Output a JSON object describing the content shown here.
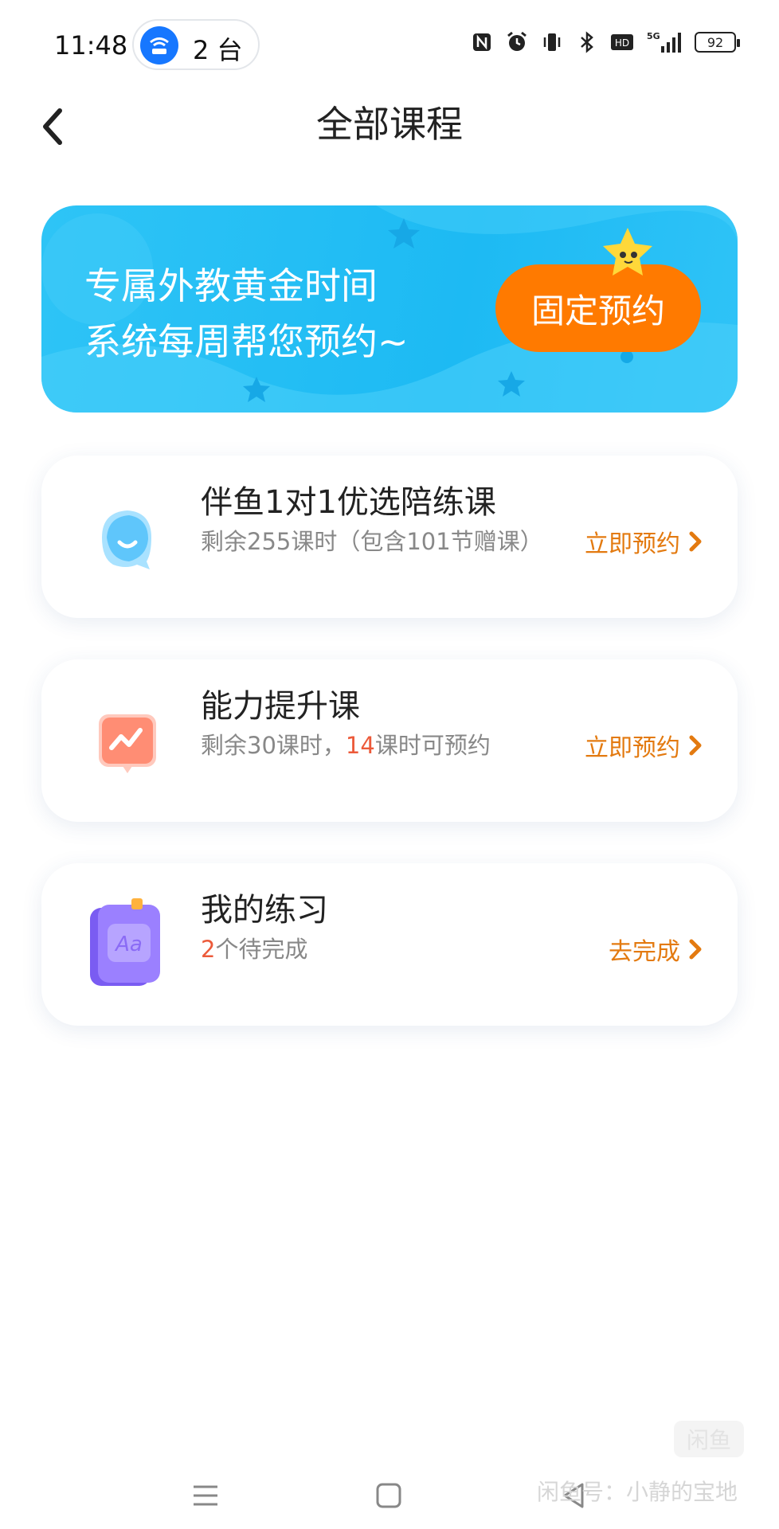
{
  "status_bar": {
    "time": "11:48",
    "hotspot_count": "2 台",
    "battery": "92"
  },
  "nav": {
    "title": "全部课程"
  },
  "banner": {
    "line1": "专属外教黄金时间",
    "line2": "系统每周帮您预约~",
    "button": "固定预约"
  },
  "courses": [
    {
      "title": "伴鱼1对1优选陪练课",
      "sub": "剩余255课时（包含101节赠课）",
      "action": "立即预约"
    },
    {
      "title": "能力提升课",
      "sub_prefix": "剩余30课时，",
      "sub_highlight": "14",
      "sub_suffix": "课时可预约",
      "action": "立即预约"
    },
    {
      "title": "我的练习",
      "sub_highlight": "2",
      "sub_suffix": "个待完成",
      "action": "去完成"
    }
  ],
  "watermark": {
    "logo": "闲鱼",
    "text": "闲鱼号：小静的宝地"
  },
  "colors": {
    "accent_orange": "#ff7a00",
    "action_text": "#e37a10",
    "highlight_red": "#ec5a3a",
    "banner_blue": "#1dbaf3"
  },
  "icons": [
    "hotspot-icon",
    "nfc-icon",
    "alarm-icon",
    "vibrate-icon",
    "bluetooth-icon",
    "hd-icon",
    "signal-5g-icon",
    "battery-icon",
    "back-icon",
    "fish-icon",
    "growth-icon",
    "book-icon",
    "chevron-right-icon",
    "menu-icon",
    "home-icon",
    "back-triangle-icon"
  ]
}
